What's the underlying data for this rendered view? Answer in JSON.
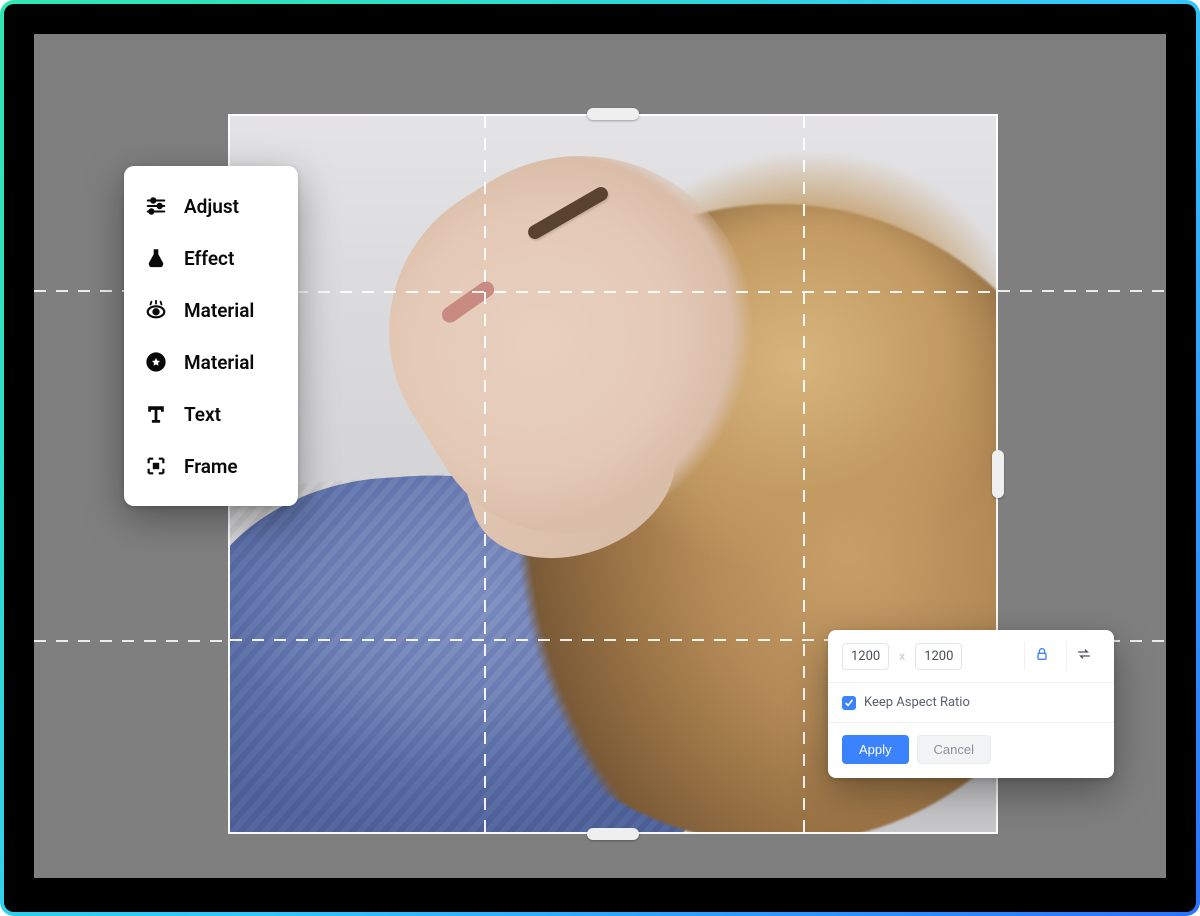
{
  "colors": {
    "accent": "#3b82ff",
    "gradient_start": "#30e6b0",
    "gradient_end": "#2a73ff"
  },
  "menu": {
    "items": [
      {
        "icon": "sliders-icon",
        "label": "Adjust"
      },
      {
        "icon": "flask-icon",
        "label": "Effect"
      },
      {
        "icon": "eye-icon",
        "label": "Material"
      },
      {
        "icon": "star-badge-icon",
        "label": "Material"
      },
      {
        "icon": "text-icon",
        "label": "Text"
      },
      {
        "icon": "frame-icon",
        "label": "Frame"
      }
    ]
  },
  "panel": {
    "width_value": "1200",
    "dim_separator": "x",
    "height_value": "1200",
    "lock_icon": "lock-icon",
    "swap_icon": "swap-icon",
    "keep_aspect_checked": true,
    "keep_aspect_label": "Keep Aspect Ratio",
    "apply_label": "Apply",
    "cancel_label": "Cancel"
  }
}
